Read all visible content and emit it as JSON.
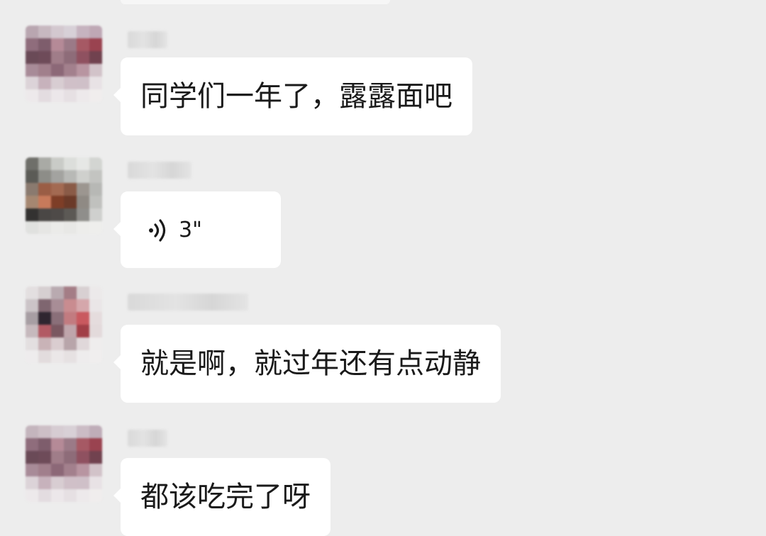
{
  "chat": {
    "messages": [
      {
        "type": "text",
        "text": "同学们一年了，露露面吧"
      },
      {
        "type": "voice",
        "duration": "3\""
      },
      {
        "type": "text",
        "text": "就是啊，就过年还有点动静"
      },
      {
        "type": "text",
        "text": "都该吃完了呀"
      }
    ]
  },
  "icons": {
    "voice": "voice-message-icon",
    "avatar": "avatar"
  },
  "colors": {
    "background": "#ededed",
    "bubble": "#ffffff",
    "text": "#1a1a1a"
  }
}
